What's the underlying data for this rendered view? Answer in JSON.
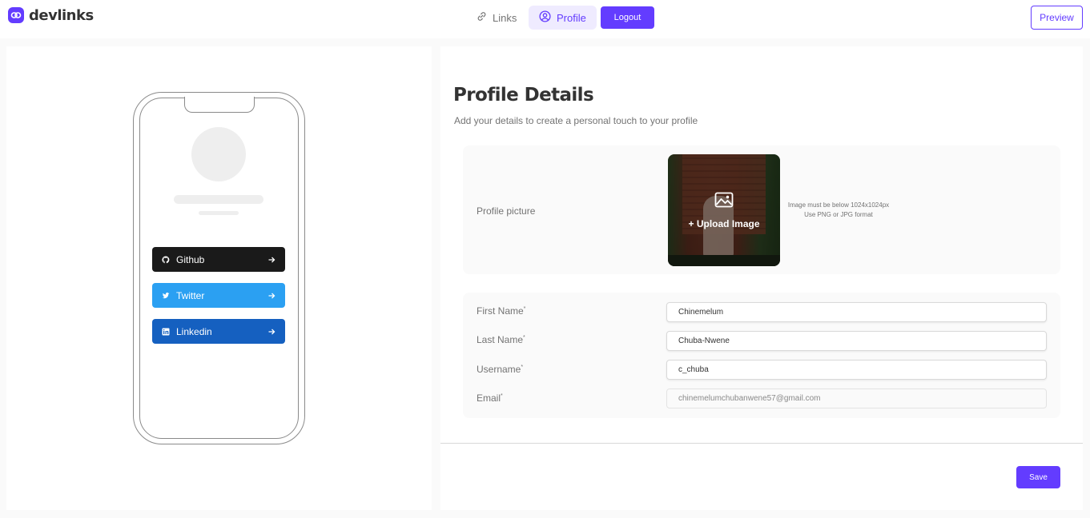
{
  "header": {
    "logo_text": "devlinks",
    "logo_icon": "link-chain-icon",
    "tabs": [
      {
        "label": "Links",
        "icon": "link-icon",
        "active": false
      },
      {
        "label": "Profile",
        "icon": "user-circle-icon",
        "active": true
      }
    ],
    "logout_label": "Logout",
    "preview_label": "Preview"
  },
  "preview": {
    "links": [
      {
        "platform": "Github",
        "icon": "github-icon",
        "color": "#1a1a1a"
      },
      {
        "platform": "Twitter",
        "icon": "twitter-icon",
        "color": "#2ba0f2"
      },
      {
        "platform": "Linkedin",
        "icon": "linkedin-icon",
        "color": "#1560c0"
      }
    ]
  },
  "profile": {
    "title": "Profile Details",
    "subtitle": "Add your details to create a personal touch to your profile",
    "picture_label": "Profile picture",
    "upload_label": "+ Upload Image",
    "upload_hint_line1": "Image must be below 1024x1024px",
    "upload_hint_line2": "Use PNG or JPG format",
    "fields": {
      "first_name": {
        "label": "First Name",
        "value": "Chinemelum"
      },
      "last_name": {
        "label": "Last Name",
        "value": "Chuba-Nwene"
      },
      "username": {
        "label": "Username",
        "value": "c_chuba"
      },
      "email": {
        "label": "Email",
        "value": "chinemelumchubanwene57@gmail.com"
      }
    },
    "required_marker": "*",
    "save_label": "Save"
  },
  "colors": {
    "accent": "#633cff",
    "accent_light": "#efebff"
  }
}
